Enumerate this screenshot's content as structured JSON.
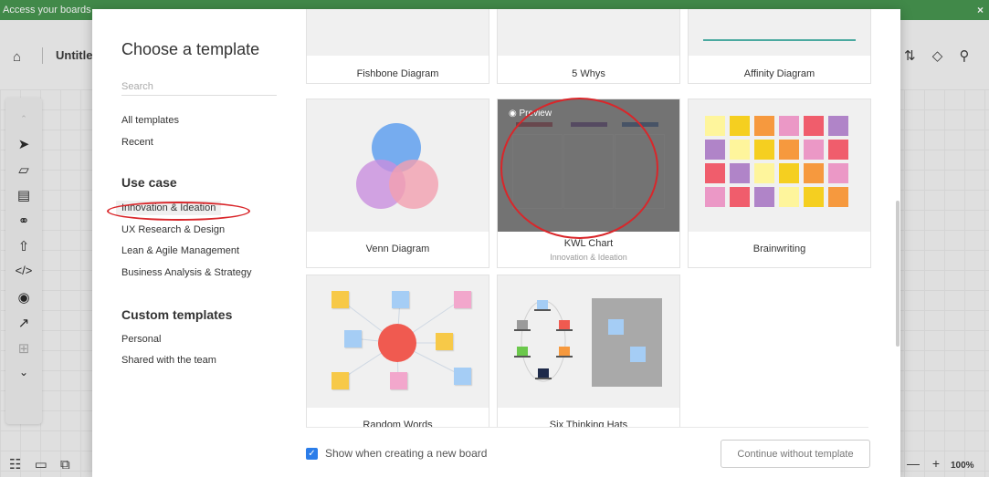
{
  "banner": {
    "text": "Access your boards",
    "close": "×"
  },
  "app": {
    "board_name": "Untitled"
  },
  "zoom": {
    "value": "100%"
  },
  "modal": {
    "title": "Choose a template",
    "search_placeholder": "Search",
    "nav": {
      "all": "All templates",
      "recent": "Recent",
      "use_case_heading": "Use case",
      "use_cases": [
        "Innovation & Ideation",
        "UX Research & Design",
        "Lean & Agile Management",
        "Business Analysis & Strategy"
      ],
      "custom_heading": "Custom templates",
      "custom": [
        "Personal",
        "Shared with the team"
      ]
    },
    "templates": {
      "fishbone": "Fishbone Diagram",
      "five_whys": "5 Whys",
      "affinity": "Affinity Diagram",
      "venn": "Venn Diagram",
      "kwl": "KWL Chart",
      "kwl_category": "Innovation & Ideation",
      "brainwriting": "Brainwriting",
      "random_words": "Random Words",
      "six_hats": "Six Thinking Hats",
      "preview_label": "Preview"
    },
    "footer": {
      "checkbox_label": "Show when creating a new board",
      "checkbox_checked": true,
      "continue_button": "Continue without template"
    }
  },
  "colors": {
    "banner": "#3f9148",
    "accent": "#2b7de9",
    "annotation": "#d9262a"
  }
}
